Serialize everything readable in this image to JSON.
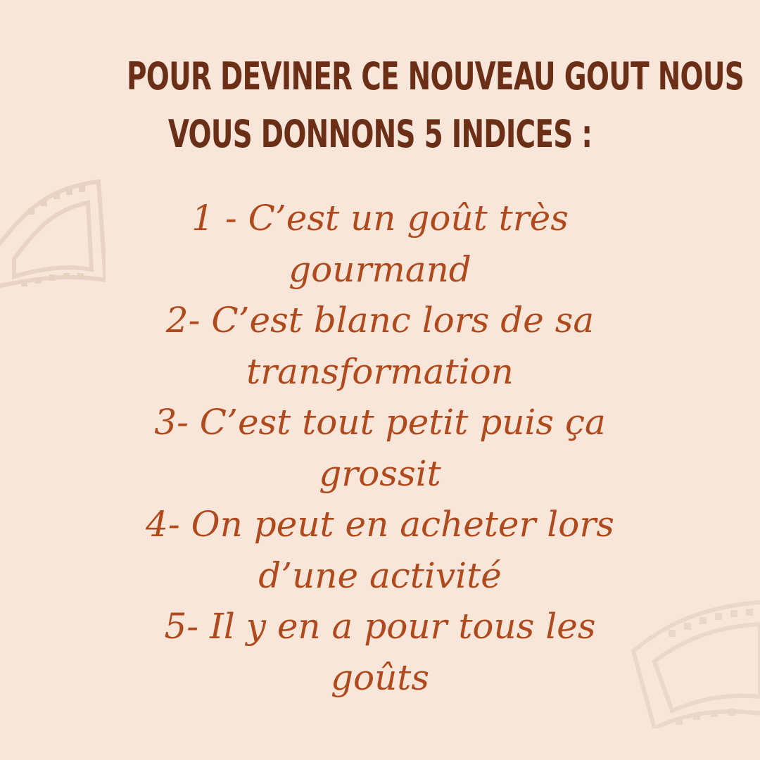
{
  "title": {
    "line1": "POUR DEVINER CE NOUVEAU GOUT NOUS",
    "line2": "VOUS DONNONS 5 INDICES :"
  },
  "clues": [
    {
      "line1": "1 - C’est un goût très",
      "line2": "gourmand"
    },
    {
      "line1": "2- C’est blanc lors de sa",
      "line2": "transformation"
    },
    {
      "line1": "3- C’est tout petit puis ça",
      "line2": "grossit"
    },
    {
      "line1": "4- On peut en acheter lors",
      "line2": "d’une activité"
    },
    {
      "line1": "5- Il y en a pour tous les",
      "line2": "goûts"
    }
  ],
  "colors": {
    "background": "#f7e6d9",
    "title": "#6b2e16",
    "clue_text": "#b04a1c",
    "decoration": "#ead7c8"
  },
  "decorations": [
    "film-strip-icon",
    "film-strip-icon"
  ]
}
